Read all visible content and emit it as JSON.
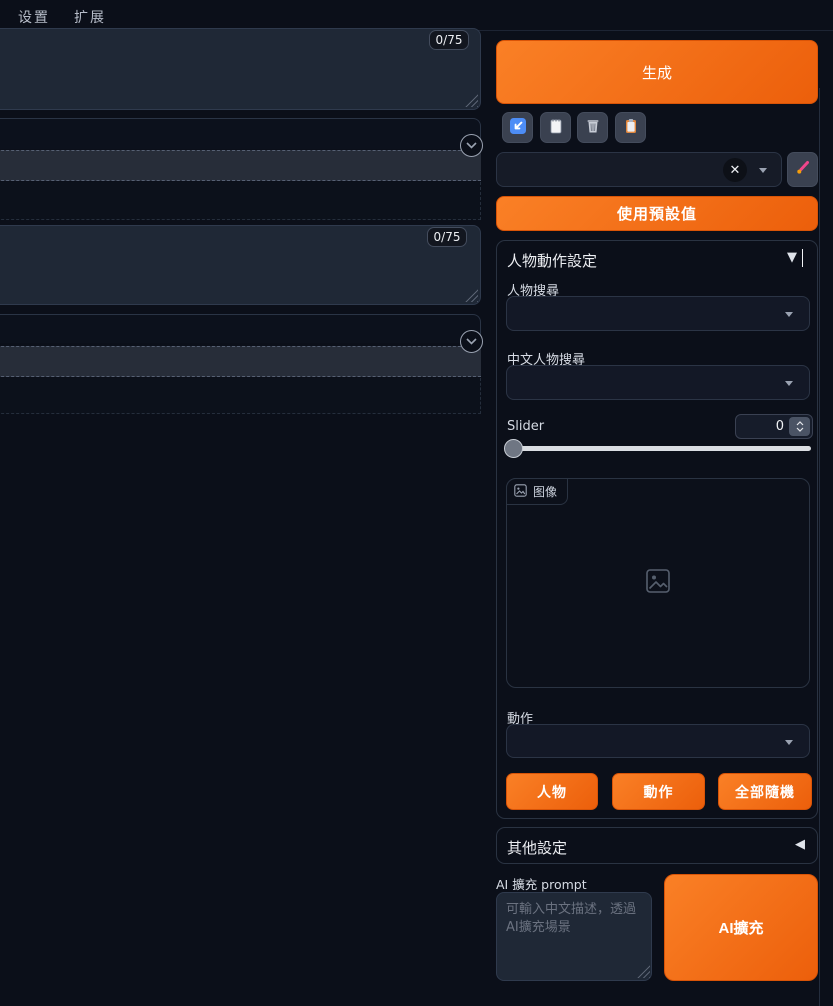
{
  "topbar": {
    "tabs": [
      "设置",
      "扩展"
    ]
  },
  "left_panel": {
    "prompt": {
      "value": "",
      "counter": "0/75"
    },
    "negative_prompt": {
      "value": "",
      "counter": "0/75"
    }
  },
  "right_panel": {
    "generate_button": "生成",
    "toolbar_icons": [
      "arrow-lower-left",
      "notepad",
      "trash",
      "clipboard"
    ],
    "styles_dropdown": {
      "value": "",
      "clear_glyph": "✕"
    },
    "edit_styles_button": "paintbrush",
    "use_preset_button": "使用預設值",
    "character_accordion": {
      "title": "人物動作設定",
      "arrow": "▼",
      "character_search_label": "人物搜尋",
      "chinese_character_search_label": "中文人物搜尋",
      "slider_label": "Slider",
      "slider_value": "0",
      "image_tab_label": "图像",
      "action_label": "動作",
      "random_buttons": [
        "人物",
        "動作",
        "全部隨機"
      ]
    },
    "other_settings": {
      "title": "其他設定",
      "arrow": "◀"
    },
    "ai_expand": {
      "label": "AI 擴充 prompt",
      "placeholder": "可輸入中文描述，透過AI擴充場景",
      "button": "AI擴充"
    },
    "colors": {
      "accent_orange": "#ee6613",
      "background": "#0b0f19"
    }
  }
}
